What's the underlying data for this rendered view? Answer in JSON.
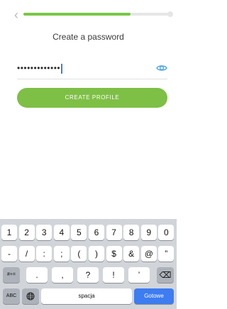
{
  "progress": {
    "value": 0.72
  },
  "header": {
    "back_icon": "‹"
  },
  "title": "Create a password",
  "password": {
    "value": "•••••••••••••",
    "toggle_icon": "eye-icon"
  },
  "button": {
    "label": "CREATE PROFILE"
  },
  "colors": {
    "accent_green": "#7ebf45",
    "accent_blue": "#3d7cf1",
    "keyboard_bg": "#d1d4d9"
  },
  "keyboard": {
    "row1": [
      "1",
      "2",
      "3",
      "4",
      "5",
      "6",
      "7",
      "8",
      "9",
      "0"
    ],
    "row2": [
      "-",
      "/",
      ":",
      ";",
      "(",
      ")",
      "$",
      "&",
      "@",
      "”"
    ],
    "row3": {
      "mode": "#+=",
      "keys": [
        ".",
        ",",
        "?",
        "!",
        "’"
      ],
      "delete_icon": "⌫"
    },
    "row4": {
      "abc": "ABC",
      "globe_icon": "globe-icon",
      "space": "spacja",
      "done": "Gotowe"
    }
  }
}
